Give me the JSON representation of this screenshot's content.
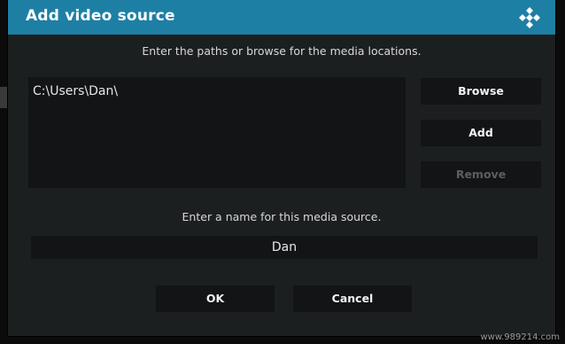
{
  "dialog": {
    "title": "Add video source",
    "logo_icon": "kodi-logo-icon",
    "instruction": "Enter the paths or browse for the media locations.",
    "paths": [
      "C:\\Users\\Dan\\"
    ],
    "buttons": {
      "browse": "Browse",
      "add": "Add",
      "remove": "Remove"
    },
    "name_prompt": "Enter a name for this media source.",
    "name_value": "Dan",
    "ok_label": "OK",
    "cancel_label": "Cancel"
  },
  "watermark": "www.989214.com",
  "colors": {
    "titlebar": "#1e7fa5",
    "dialog_bg": "#1c1f20",
    "field_bg": "#121415",
    "text": "#f2f2f2",
    "disabled_text": "#5c5f60"
  }
}
